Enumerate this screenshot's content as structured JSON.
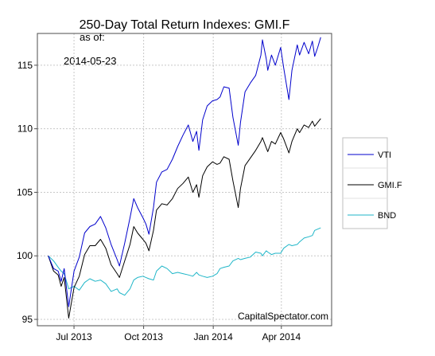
{
  "chart_data": {
    "type": "line",
    "title": "250-Day Total Return Indexes: GMI.F",
    "subtitle_label": "as of:",
    "subtitle_date": "2014-05-23",
    "credit": "CapitalSpectator.com",
    "xlabel": "",
    "ylabel": "",
    "x_range": [
      "2013-05-28",
      "2014-05-23"
    ],
    "ylim": [
      94.5,
      117.5
    ],
    "y_ticks": [
      95,
      100,
      105,
      110,
      115
    ],
    "x_ticks": [
      {
        "date": "2013-07-01",
        "label": "Jul 2013"
      },
      {
        "date": "2013-10-01",
        "label": "Oct 2013"
      },
      {
        "date": "2014-01-01",
        "label": "Jan 2014"
      },
      {
        "date": "2014-04-01",
        "label": "Apr 2014"
      }
    ],
    "grid": true,
    "legend_position": "right",
    "series": [
      {
        "name": "VTI",
        "color": "#0000cc",
        "points": [
          [
            "2013-05-28",
            100.0
          ],
          [
            "2013-06-04",
            99.0
          ],
          [
            "2013-06-10",
            98.8
          ],
          [
            "2013-06-14",
            98.0
          ],
          [
            "2013-06-18",
            99.0
          ],
          [
            "2013-06-24",
            96.0
          ],
          [
            "2013-07-01",
            98.8
          ],
          [
            "2013-07-08",
            99.9
          ],
          [
            "2013-07-15",
            101.8
          ],
          [
            "2013-07-22",
            102.3
          ],
          [
            "2013-07-29",
            102.5
          ],
          [
            "2013-08-05",
            103.1
          ],
          [
            "2013-08-12",
            102.2
          ],
          [
            "2013-08-19",
            100.9
          ],
          [
            "2013-08-27",
            99.7
          ],
          [
            "2013-08-30",
            99.2
          ],
          [
            "2013-09-06",
            101.0
          ],
          [
            "2013-09-13",
            103.0
          ],
          [
            "2013-09-18",
            104.5
          ],
          [
            "2013-09-23",
            103.8
          ],
          [
            "2013-09-30",
            103.0
          ],
          [
            "2013-10-04",
            102.5
          ],
          [
            "2013-10-08",
            101.7
          ],
          [
            "2013-10-14",
            103.8
          ],
          [
            "2013-10-18",
            105.8
          ],
          [
            "2013-10-25",
            106.6
          ],
          [
            "2013-11-01",
            106.8
          ],
          [
            "2013-11-08",
            107.6
          ],
          [
            "2013-11-15",
            108.6
          ],
          [
            "2013-11-22",
            109.5
          ],
          [
            "2013-11-29",
            110.3
          ],
          [
            "2013-12-05",
            109.0
          ],
          [
            "2013-12-10",
            109.8
          ],
          [
            "2013-12-13",
            108.3
          ],
          [
            "2013-12-18",
            110.7
          ],
          [
            "2013-12-24",
            111.8
          ],
          [
            "2013-12-31",
            112.2
          ],
          [
            "2014-01-06",
            112.3
          ],
          [
            "2014-01-10",
            112.5
          ],
          [
            "2014-01-15",
            113.3
          ],
          [
            "2014-01-22",
            113.2
          ],
          [
            "2014-01-27",
            110.9
          ],
          [
            "2014-02-03",
            108.7
          ],
          [
            "2014-02-06",
            110.5
          ],
          [
            "2014-02-12",
            112.9
          ],
          [
            "2014-02-19",
            113.6
          ],
          [
            "2014-02-26",
            114.2
          ],
          [
            "2014-03-05",
            115.8
          ],
          [
            "2014-03-07",
            117.0
          ],
          [
            "2014-03-12",
            115.5
          ],
          [
            "2014-03-14",
            114.6
          ],
          [
            "2014-03-19",
            115.8
          ],
          [
            "2014-03-24",
            115.0
          ],
          [
            "2014-03-31",
            116.4
          ],
          [
            "2014-04-04",
            114.8
          ],
          [
            "2014-04-11",
            112.3
          ],
          [
            "2014-04-15",
            114.6
          ],
          [
            "2014-04-22",
            116.6
          ],
          [
            "2014-04-25",
            115.8
          ],
          [
            "2014-05-01",
            116.8
          ],
          [
            "2014-05-07",
            115.9
          ],
          [
            "2014-05-12",
            116.9
          ],
          [
            "2014-05-15",
            115.7
          ],
          [
            "2014-05-19",
            116.4
          ],
          [
            "2014-05-23",
            117.2
          ]
        ]
      },
      {
        "name": "GMI.F",
        "color": "#000000",
        "points": [
          [
            "2013-05-28",
            100.0
          ],
          [
            "2013-06-04",
            98.8
          ],
          [
            "2013-06-10",
            98.5
          ],
          [
            "2013-06-14",
            97.6
          ],
          [
            "2013-06-18",
            98.3
          ],
          [
            "2013-06-24",
            95.1
          ],
          [
            "2013-07-01",
            97.5
          ],
          [
            "2013-07-08",
            98.4
          ],
          [
            "2013-07-15",
            100.1
          ],
          [
            "2013-07-22",
            100.8
          ],
          [
            "2013-07-29",
            100.8
          ],
          [
            "2013-08-05",
            101.3
          ],
          [
            "2013-08-12",
            100.6
          ],
          [
            "2013-08-19",
            99.3
          ],
          [
            "2013-08-27",
            98.6
          ],
          [
            "2013-08-30",
            98.3
          ],
          [
            "2013-09-06",
            99.6
          ],
          [
            "2013-09-13",
            100.9
          ],
          [
            "2013-09-18",
            102.3
          ],
          [
            "2013-09-23",
            101.8
          ],
          [
            "2013-09-30",
            101.3
          ],
          [
            "2013-10-04",
            101.0
          ],
          [
            "2013-10-08",
            100.4
          ],
          [
            "2013-10-14",
            102.0
          ],
          [
            "2013-10-18",
            103.6
          ],
          [
            "2013-10-25",
            104.1
          ],
          [
            "2013-11-01",
            104.0
          ],
          [
            "2013-11-08",
            104.5
          ],
          [
            "2013-11-15",
            105.3
          ],
          [
            "2013-11-22",
            105.7
          ],
          [
            "2013-11-29",
            106.2
          ],
          [
            "2013-12-05",
            105.0
          ],
          [
            "2013-12-10",
            105.6
          ],
          [
            "2013-12-13",
            104.6
          ],
          [
            "2013-12-18",
            106.3
          ],
          [
            "2013-12-24",
            107.0
          ],
          [
            "2013-12-31",
            107.4
          ],
          [
            "2014-01-06",
            107.2
          ],
          [
            "2014-01-10",
            107.3
          ],
          [
            "2014-01-15",
            107.8
          ],
          [
            "2014-01-22",
            107.6
          ],
          [
            "2014-01-27",
            105.9
          ],
          [
            "2014-02-03",
            103.8
          ],
          [
            "2014-02-06",
            105.3
          ],
          [
            "2014-02-12",
            107.1
          ],
          [
            "2014-02-19",
            107.7
          ],
          [
            "2014-02-26",
            108.3
          ],
          [
            "2014-03-05",
            109.0
          ],
          [
            "2014-03-07",
            109.3
          ],
          [
            "2014-03-12",
            108.5
          ],
          [
            "2014-03-14",
            108.2
          ],
          [
            "2014-03-19",
            109.0
          ],
          [
            "2014-03-24",
            108.8
          ],
          [
            "2014-03-31",
            109.7
          ],
          [
            "2014-04-04",
            109.2
          ],
          [
            "2014-04-11",
            108.1
          ],
          [
            "2014-04-15",
            109.0
          ],
          [
            "2014-04-22",
            110.0
          ],
          [
            "2014-04-25",
            109.7
          ],
          [
            "2014-05-01",
            110.3
          ],
          [
            "2014-05-07",
            110.1
          ],
          [
            "2014-05-12",
            110.6
          ],
          [
            "2014-05-15",
            110.2
          ],
          [
            "2014-05-19",
            110.5
          ],
          [
            "2014-05-23",
            110.8
          ]
        ]
      },
      {
        "name": "BND",
        "color": "#1fb6c8",
        "points": [
          [
            "2013-05-28",
            100.0
          ],
          [
            "2013-06-04",
            99.6
          ],
          [
            "2013-06-10",
            99.1
          ],
          [
            "2013-06-14",
            98.8
          ],
          [
            "2013-06-18",
            98.6
          ],
          [
            "2013-06-24",
            97.4
          ],
          [
            "2013-07-01",
            97.6
          ],
          [
            "2013-07-08",
            97.3
          ],
          [
            "2013-07-15",
            97.9
          ],
          [
            "2013-07-22",
            98.2
          ],
          [
            "2013-07-29",
            98.0
          ],
          [
            "2013-08-05",
            98.1
          ],
          [
            "2013-08-12",
            97.8
          ],
          [
            "2013-08-19",
            97.2
          ],
          [
            "2013-08-27",
            97.4
          ],
          [
            "2013-08-30",
            97.1
          ],
          [
            "2013-09-06",
            96.9
          ],
          [
            "2013-09-13",
            97.4
          ],
          [
            "2013-09-18",
            98.1
          ],
          [
            "2013-09-23",
            98.3
          ],
          [
            "2013-09-30",
            98.4
          ],
          [
            "2013-10-04",
            98.3
          ],
          [
            "2013-10-08",
            98.2
          ],
          [
            "2013-10-14",
            98.1
          ],
          [
            "2013-10-18",
            98.8
          ],
          [
            "2013-10-25",
            99.2
          ],
          [
            "2013-11-01",
            99.0
          ],
          [
            "2013-11-08",
            98.6
          ],
          [
            "2013-11-15",
            98.7
          ],
          [
            "2013-11-22",
            98.6
          ],
          [
            "2013-11-29",
            98.5
          ],
          [
            "2013-12-05",
            98.4
          ],
          [
            "2013-12-10",
            98.7
          ],
          [
            "2013-12-13",
            98.5
          ],
          [
            "2013-12-18",
            98.4
          ],
          [
            "2013-12-24",
            98.3
          ],
          [
            "2013-12-31",
            98.4
          ],
          [
            "2014-01-06",
            98.6
          ],
          [
            "2014-01-10",
            99.0
          ],
          [
            "2014-01-15",
            99.1
          ],
          [
            "2014-01-22",
            99.2
          ],
          [
            "2014-01-27",
            99.6
          ],
          [
            "2014-02-03",
            99.8
          ],
          [
            "2014-02-06",
            99.7
          ],
          [
            "2014-02-12",
            99.8
          ],
          [
            "2014-02-19",
            99.9
          ],
          [
            "2014-02-26",
            100.3
          ],
          [
            "2014-03-05",
            100.2
          ],
          [
            "2014-03-07",
            100.0
          ],
          [
            "2014-03-12",
            100.4
          ],
          [
            "2014-03-14",
            100.3
          ],
          [
            "2014-03-19",
            100.1
          ],
          [
            "2014-03-24",
            100.2
          ],
          [
            "2014-03-31",
            100.2
          ],
          [
            "2014-04-04",
            100.6
          ],
          [
            "2014-04-11",
            100.9
          ],
          [
            "2014-04-15",
            100.8
          ],
          [
            "2014-04-22",
            100.9
          ],
          [
            "2014-04-25",
            101.1
          ],
          [
            "2014-05-01",
            101.4
          ],
          [
            "2014-05-07",
            101.5
          ],
          [
            "2014-05-12",
            101.6
          ],
          [
            "2014-05-15",
            102.0
          ],
          [
            "2014-05-19",
            102.1
          ],
          [
            "2014-05-23",
            102.2
          ]
        ]
      }
    ]
  }
}
